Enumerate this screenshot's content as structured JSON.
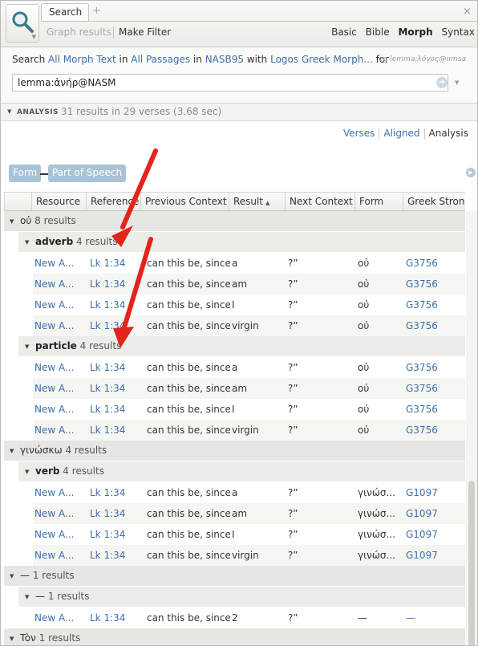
{
  "header": {
    "tab_label": "Search",
    "add_tab": "+",
    "close_tab": "×",
    "toolbar": {
      "graph_results": "Graph results",
      "make_filter": "Make Filter",
      "search_types": [
        "Basic",
        "Bible",
        "Morph",
        "Syntax"
      ],
      "active_type": "Morph"
    }
  },
  "query": {
    "p1": "Search ",
    "all_morph_text": "All Morph Text",
    "p2": " in ",
    "all_passages": "All Passages",
    "p3": " in ",
    "resource": "NASB95",
    "p4": " with ",
    "morphology": "Logos Greek Morph...",
    "p5": " for",
    "example": "eg lemma:λόγος@nmsa",
    "input_value": "lemma:ἀνήρ@NASM",
    "go_icon": "➔"
  },
  "analysis": {
    "label": "ANALYSIS",
    "summary": "31 results in 29 verses (3.68 sec)"
  },
  "view_tabs": [
    "Verses",
    "Aligned",
    "Analysis"
  ],
  "active_view": "Analysis",
  "grouping": {
    "pill1": "Form",
    "pill2": "Part of Speech"
  },
  "columns": [
    "Resource",
    "Reference",
    "Previous Context",
    "Result",
    "Next Context",
    "Form",
    "Greek Strong"
  ],
  "rows": [
    {
      "kind": "g1",
      "key": "οὐ",
      "count": "8 results"
    },
    {
      "kind": "g2",
      "key": "adverb",
      "count": "4 results"
    },
    {
      "kind": "d",
      "res": "New A...",
      "ref": "Lk 1:34",
      "prev": "can this be, since",
      "result": "a",
      "next": "?”",
      "form": "οὐ",
      "strong": "G3756"
    },
    {
      "kind": "d",
      "res": "New A...",
      "ref": "Lk 1:34",
      "prev": "can this be, since",
      "result": "am",
      "next": "?”",
      "form": "οὐ",
      "strong": "G3756"
    },
    {
      "kind": "d",
      "res": "New A...",
      "ref": "Lk 1:34",
      "prev": "can this be, since",
      "result": "I",
      "next": "?”",
      "form": "οὐ",
      "strong": "G3756"
    },
    {
      "kind": "d",
      "res": "New A...",
      "ref": "Lk 1:34",
      "prev": "can this be, since",
      "result": "virgin",
      "next": "?”",
      "form": "οὐ",
      "strong": "G3756"
    },
    {
      "kind": "g2",
      "key": "particle",
      "count": "4 results"
    },
    {
      "kind": "d",
      "res": "New A...",
      "ref": "Lk 1:34",
      "prev": "can this be, since",
      "result": "a",
      "next": "?”",
      "form": "οὐ",
      "strong": "G3756"
    },
    {
      "kind": "d",
      "res": "New A...",
      "ref": "Lk 1:34",
      "prev": "can this be, since",
      "result": "am",
      "next": "?”",
      "form": "οὐ",
      "strong": "G3756"
    },
    {
      "kind": "d",
      "res": "New A...",
      "ref": "Lk 1:34",
      "prev": "can this be, since",
      "result": "I",
      "next": "?”",
      "form": "οὐ",
      "strong": "G3756"
    },
    {
      "kind": "d",
      "res": "New A...",
      "ref": "Lk 1:34",
      "prev": "can this be, since",
      "result": "virgin",
      "next": "?”",
      "form": "οὐ",
      "strong": "G3756"
    },
    {
      "kind": "g1",
      "key": "γινώσκω",
      "count": "4 results"
    },
    {
      "kind": "g2",
      "key": "verb",
      "count": "4 results"
    },
    {
      "kind": "d",
      "res": "New A...",
      "ref": "Lk 1:34",
      "prev": "can this be, since",
      "result": "a",
      "next": "?”",
      "form": "γινώσ...",
      "strong": "G1097"
    },
    {
      "kind": "d",
      "res": "New A...",
      "ref": "Lk 1:34",
      "prev": "can this be, since",
      "result": "am",
      "next": "?”",
      "form": "γινώσ...",
      "strong": "G1097"
    },
    {
      "kind": "d",
      "res": "New A...",
      "ref": "Lk 1:34",
      "prev": "can this be, since",
      "result": "I",
      "next": "?”",
      "form": "γινώσ...",
      "strong": "G1097"
    },
    {
      "kind": "d",
      "res": "New A...",
      "ref": "Lk 1:34",
      "prev": "can this be, since",
      "result": "virgin",
      "next": "?”",
      "form": "γινώσ...",
      "strong": "G1097"
    },
    {
      "kind": "g1",
      "key": "—",
      "count": "1 results"
    },
    {
      "kind": "g3",
      "key": "—",
      "count": "1 results"
    },
    {
      "kind": "d",
      "res": "New A...",
      "ref": "Lk 1:34",
      "prev": "can this be, since",
      "result": "2",
      "next": "?”",
      "form": "—",
      "strong": "—"
    },
    {
      "kind": "g1",
      "key": "Tòν",
      "count": "1 results"
    }
  ],
  "colors": {
    "link": "#3d6fa8",
    "pill": "#a9c3d6",
    "group_bg": "#e6e6e2",
    "arrow": "#e3241b"
  }
}
